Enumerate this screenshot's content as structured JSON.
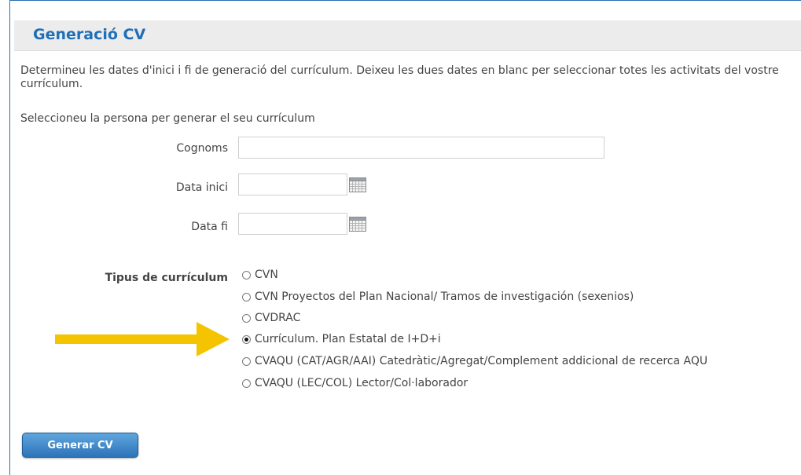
{
  "page": {
    "title": "Generació CV",
    "intro": "Determineu les dates d'inici i fi de generació del currículum. Deixeu les dues dates en blanc per seleccionar totes les activitats del vostre currículum.",
    "select_person": "Seleccioneu la persona per generar el seu currículum"
  },
  "form": {
    "cognoms": {
      "label": "Cognoms",
      "value": "",
      "placeholder": ""
    },
    "data_inici": {
      "label": "Data inici",
      "value": "",
      "placeholder": "",
      "icon": "calendar-icon"
    },
    "data_fi": {
      "label": "Data fi",
      "value": "",
      "placeholder": "",
      "icon": "calendar-icon"
    },
    "tipus": {
      "label": "Tipus de currículum",
      "options": [
        {
          "label": "CVN",
          "checked": false
        },
        {
          "label": "CVN Proyectos del Plan Nacional/ Tramos de investigación (sexenios)",
          "checked": false
        },
        {
          "label": "CVDRAC",
          "checked": false
        },
        {
          "label": "Currículum. Plan Estatal de I+D+i",
          "checked": true
        },
        {
          "label": "CVAQU (CAT/AGR/AAI) Catedràtic/Agregat/Complement addicional de recerca AQU",
          "checked": false
        },
        {
          "label": "CVAQU (LEC/COL) Lector/Col·laborador",
          "checked": false
        }
      ]
    },
    "submit_label": "Generar CV"
  },
  "annotation": {
    "icon": "arrow-right-icon",
    "color": "#f5c400"
  },
  "colors": {
    "title": "#1e6fb8",
    "button": "#2d73b8",
    "border": "#2a6fb0"
  }
}
